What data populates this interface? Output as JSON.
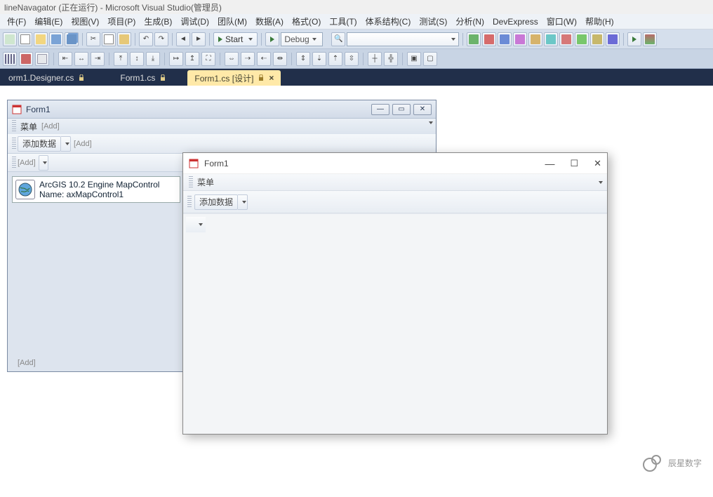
{
  "titlebar": "lineNavagator (正在运行) - Microsoft Visual Studio(管理员)",
  "menu": {
    "file": "件(F)",
    "edit": "编辑(E)",
    "view": "视图(V)",
    "project": "项目(P)",
    "build": "生成(B)",
    "debug": "调试(D)",
    "team": "团队(M)",
    "data": "数据(A)",
    "format": "格式(O)",
    "tools": "工具(T)",
    "arch": "体系结构(C)",
    "test": "测试(S)",
    "analyze": "分析(N)",
    "dx": "DevExpress",
    "window": "窗口(W)",
    "help": "帮助(H)"
  },
  "toolbar": {
    "start": "Start",
    "config": "Debug"
  },
  "tabs": {
    "designer": "orm1.Designer.cs",
    "code": "Form1.cs",
    "design": "Form1.cs [设计]"
  },
  "designer_form": {
    "title": "Form1",
    "menu_label": "菜单",
    "add_tag": "[Add]",
    "toolstrip_btn": "添加数据",
    "mapcontrol_line1": "ArcGIS 10.2 Engine MapControl",
    "mapcontrol_line2": "Name: axMapControl1"
  },
  "runtime_form": {
    "title": "Form1",
    "menu_label": "菜单",
    "toolstrip_btn": "添加数据"
  },
  "minimize": "—",
  "maximize": "☐",
  "close": "✕",
  "watermark": "辰星数字"
}
